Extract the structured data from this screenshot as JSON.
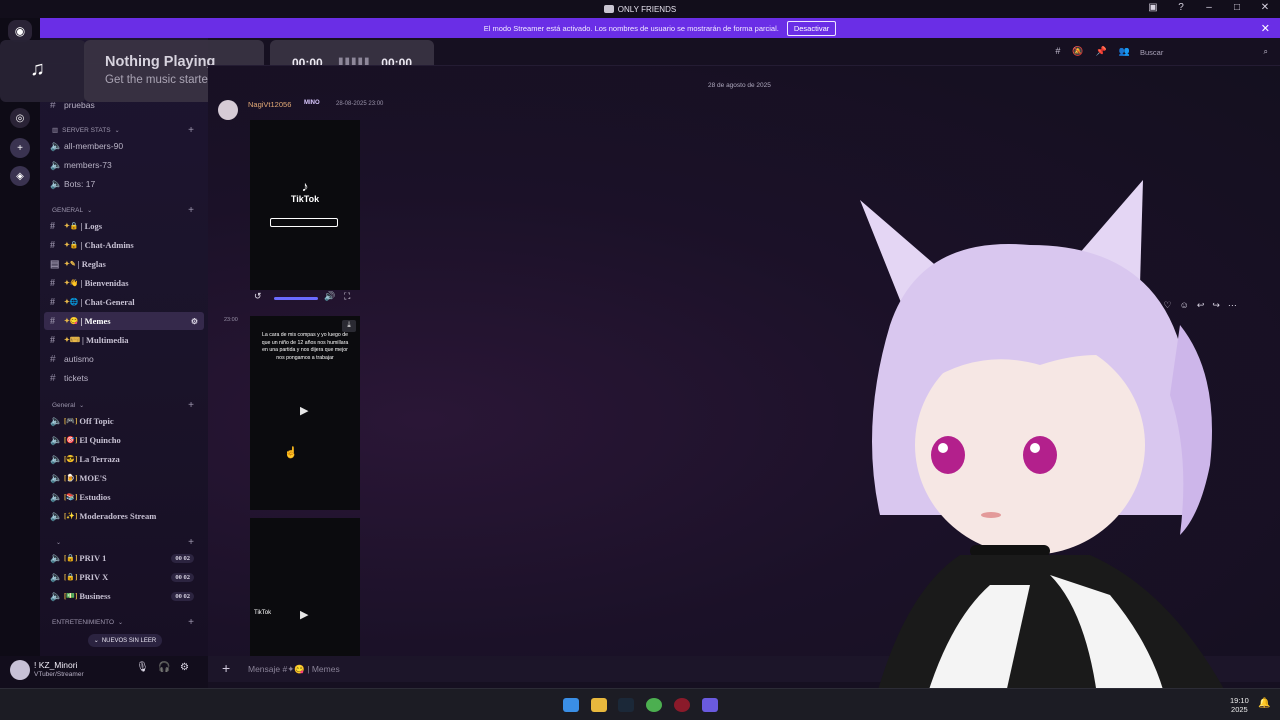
{
  "window": {
    "title": "ONLY FRIENDS"
  },
  "banner": {
    "text": "El modo Streamer está activado. Los nombres de usuario se mostrarán de forma parcial.",
    "button": "Desactivar"
  },
  "music": {
    "title": "Nothing Playing",
    "subtitle": "Get the music started",
    "time_start": "00:00",
    "time_end": "00:00"
  },
  "search": {
    "placeholder": "Buscar"
  },
  "sidebar": {
    "top_channel": "pruebas",
    "categories": {
      "server_stats": "SERVER STATS",
      "general_upper": "GENERAL",
      "general_voice": "General",
      "entretenimiento": "ENTRETENIMIENTO"
    },
    "stats_channels": [
      "all-members-90",
      "members-73",
      "Bots: 17"
    ],
    "text_channels": [
      "| Logs",
      "| Chat-Admins",
      "| Reglas",
      "| Bienvenidas",
      "| Chat-General",
      "| Memes",
      "| Multimedia"
    ],
    "plain_channels": [
      "autismo",
      "tickets"
    ],
    "voice_channels": [
      "Off Topic",
      "El Quincho",
      "La Terraza",
      "MOE'S",
      "Estudios",
      "Moderadores Stream"
    ],
    "private_channels": [
      {
        "name": "PRIV 1",
        "count": "00 02"
      },
      {
        "name": "PRIV X",
        "count": "00 02"
      },
      {
        "name": "Business",
        "count": "00 02"
      }
    ],
    "unread_pill": "NUEVOS SIN LEER"
  },
  "user": {
    "name": "! KZ_Minori",
    "status": "VTuber/Streamer"
  },
  "chat": {
    "date_separator": "28 de agosto de 2025",
    "author": "NagiVt12056",
    "author_tag": "MINO",
    "timestamp": "28-08-2025 23:00",
    "side_time": "23:00",
    "video1_logo": "TikTok",
    "video2_caption": "La cara de mis compas y yo luego de que un niño de 12 años nos humillara en una partida y nos dijera que mejor nos pongamos a trabajar",
    "video3_logo": "TikTok"
  },
  "composer": {
    "placeholder": "Mensaje #✦😋 | Memes"
  },
  "clock": {
    "time": "19:10",
    "date": "2025"
  },
  "colors": {
    "banner": "#6a2ee6",
    "accent": "#6b6bff"
  }
}
